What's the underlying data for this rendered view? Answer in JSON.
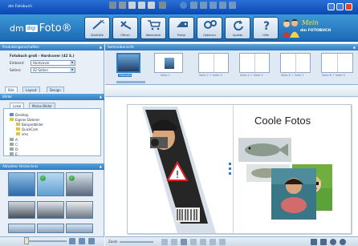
{
  "window": {
    "title": "dm Fotobuch"
  },
  "brand": {
    "part1": "dm",
    "part2": "digi",
    "part3": "Foto®"
  },
  "toolbar": [
    {
      "label": "Starthilfe",
      "icon": "wand-icon"
    },
    {
      "label": "Öffnen",
      "icon": "open-icon"
    },
    {
      "label": "Warenkorb",
      "icon": "cart-icon"
    },
    {
      "label": "Preise",
      "icon": "price-icon"
    },
    {
      "label": "Optionen",
      "icon": "gear-icon"
    },
    {
      "label": "Update",
      "icon": "refresh-icon"
    },
    {
      "label": "Hilfe",
      "icon": "help-icon"
    }
  ],
  "banner": {
    "script": "Mein",
    "text": "dm FOTOBUCH"
  },
  "product_panel": {
    "title": "Produkteigenschaften",
    "product": "Fotobuch groß - Hardcover (42 S.)",
    "binding_label": "Einband:",
    "binding_value": "Hardcover",
    "pages_label": "Seiten:",
    "pages_value": "42 Seiten"
  },
  "tabs": [
    "Bild",
    "Layout",
    "Design"
  ],
  "images_panel": {
    "title": "Bilder",
    "subtabs": [
      "Lokal",
      "Meine Bilder"
    ],
    "tree": [
      "Desktop",
      "Eigene Dateien",
      "Beispielbilder",
      "QuickCam",
      "sms",
      "A:",
      "C:",
      "D:",
      "E:"
    ]
  },
  "folder_panel": {
    "title": "Aktuelles Verzeichnis"
  },
  "pages_strip": {
    "title": "Seitenübersicht",
    "pages": [
      "Titelseite",
      "Seite 1",
      "Seite 2 + Seite 3",
      "Seite 4 + Seite 5",
      "Seite 6 + Seite 7",
      "Seite 8 + Seite 9"
    ],
    "selected": 0
  },
  "page": {
    "title": "Coole Fotos"
  },
  "status": {
    "zoom_label": "Zoom"
  },
  "colors": {
    "accent": "#2e7cc2",
    "header": "#1d69b4"
  }
}
